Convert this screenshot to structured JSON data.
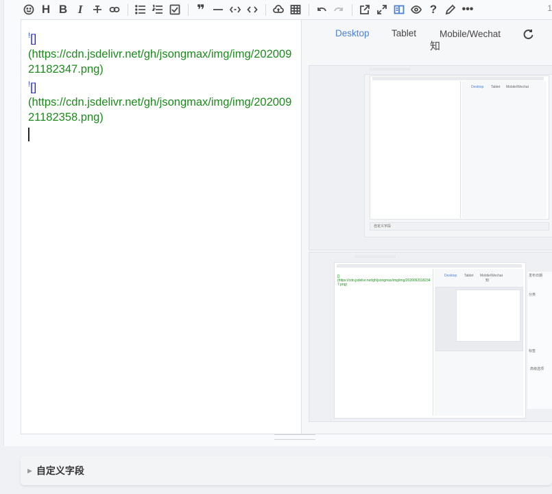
{
  "toolbar": {
    "right_text": "1"
  },
  "editor": {
    "lines": [
      {
        "bang": "!",
        "open": "[",
        "close": "]",
        "url": "(https://cdn.jsdelivr.net/gh/jsongmax/img/img/20200921182347.png)"
      },
      {
        "bang": "!",
        "open": "[",
        "close": "]",
        "url": "(https://cdn.jsdelivr.net/gh/jsongmax/img/img/20200921182358.png)"
      }
    ]
  },
  "preview": {
    "tabs": {
      "desktop": "Desktop",
      "tablet": "Tablet",
      "mobile": "Mobile/Wechat",
      "zhihu": "知"
    },
    "nested_shot_1": {
      "tabs": [
        "Desktop",
        "Tablet",
        "Mobile/Wechat"
      ],
      "custom_field": "自定义字段"
    },
    "nested_shot_2": {
      "link_text": "[]\n(https://cdn.jsdelivr.net/gh/jsongmax/img/img/20200921182347.png)",
      "tabs": [
        "Desktop",
        "Tablet",
        "Mobile/Wechat"
      ],
      "zhihu": "知",
      "sidebar": [
        "发布日期",
        "分类",
        "标签",
        "高级选项"
      ]
    }
  },
  "custom_field": {
    "label": "自定义字段"
  }
}
